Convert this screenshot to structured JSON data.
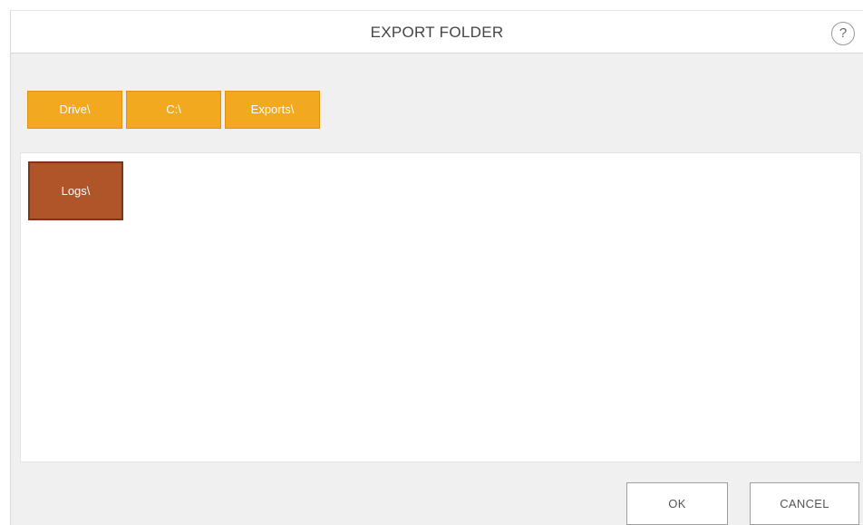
{
  "dialog": {
    "title": "EXPORT FOLDER",
    "help_label": "?"
  },
  "breadcrumb": {
    "items": [
      {
        "label": "Drive\\"
      },
      {
        "label": "C:\\"
      },
      {
        "label": "Exports\\"
      }
    ]
  },
  "folders": {
    "items": [
      {
        "label": "Logs\\"
      }
    ]
  },
  "footer": {
    "ok_label": "OK",
    "cancel_label": "CANCEL"
  },
  "colors": {
    "breadcrumb_fill": "#f2a91f",
    "folder_fill": "#b0552a",
    "dialog_background": "#f0f0f0"
  },
  "icons": {
    "help": "help-icon"
  }
}
